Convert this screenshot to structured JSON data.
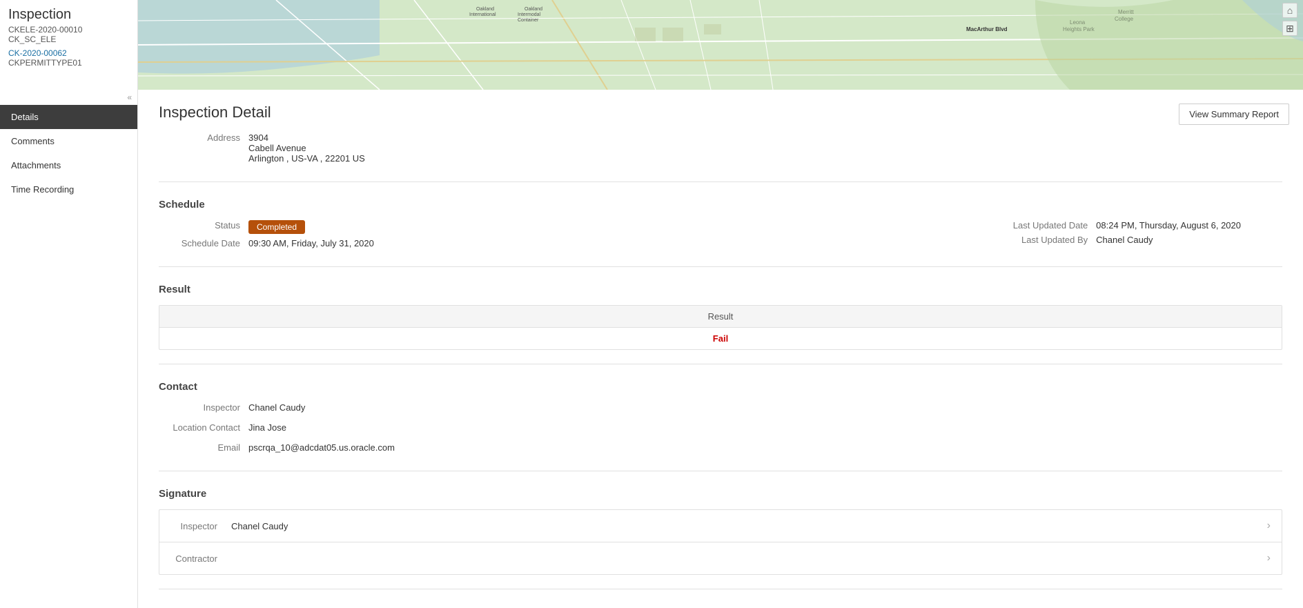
{
  "app": {
    "title": "Inspection",
    "record_id": "CKELE-2020-00010",
    "record_type": "CK_SC_ELE",
    "permit_link": "CK-2020-00062",
    "permit_type": "CKPERMITTYPE01"
  },
  "sidebar": {
    "collapse_icon": "«",
    "nav_items": [
      {
        "label": "Details",
        "active": true
      },
      {
        "label": "Comments",
        "active": false
      },
      {
        "label": "Attachments",
        "active": false
      },
      {
        "label": "Time Recording",
        "active": false
      }
    ]
  },
  "main": {
    "page_title": "Inspection Detail",
    "view_summary_btn": "View Summary Report",
    "address": {
      "label": "Address",
      "number": "3904",
      "street": "Cabell Avenue",
      "city_state_zip": "Arlington , US-VA , 22201 US"
    },
    "schedule": {
      "section_title": "Schedule",
      "status_label": "Status",
      "status_value": "Completed",
      "schedule_date_label": "Schedule Date",
      "schedule_date_value": "09:30 AM, Friday, July 31, 2020",
      "last_updated_date_label": "Last Updated Date",
      "last_updated_date_value": "08:24 PM, Thursday, August 6, 2020",
      "last_updated_by_label": "Last Updated By",
      "last_updated_by_value": "Chanel Caudy"
    },
    "result": {
      "section_title": "Result",
      "column_header": "Result",
      "result_value": "Fail"
    },
    "contact": {
      "section_title": "Contact",
      "inspector_label": "Inspector",
      "inspector_value": "Chanel Caudy",
      "location_contact_label": "Location Contact",
      "location_contact_value": "Jina Jose",
      "email_label": "Email",
      "email_value": "pscrqa_10@adcdat05.us.oracle.com"
    },
    "signature": {
      "section_title": "Signature",
      "rows": [
        {
          "label": "Inspector",
          "value": "Chanel Caudy"
        },
        {
          "label": "Contractor",
          "value": ""
        }
      ]
    }
  },
  "icons": {
    "home": "⌂",
    "grid": "⊞",
    "chevron_right": "›",
    "collapse": "«"
  }
}
